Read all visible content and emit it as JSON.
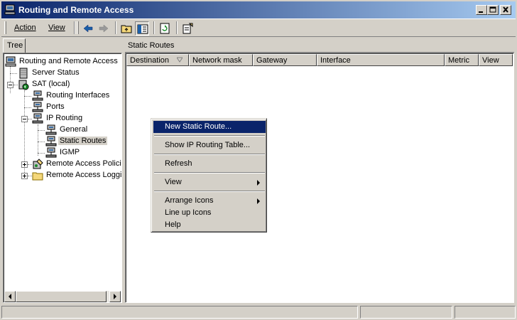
{
  "window": {
    "title": "Routing and Remote Access",
    "title_bg": "#0a246a"
  },
  "toolbar": {
    "menus": [
      "Action",
      "View"
    ],
    "tools": [
      "back-arrow-icon",
      "forward-arrow-icon",
      "up-folder-icon",
      "show-hide-tree-icon",
      "refresh-icon",
      "properties-icon"
    ]
  },
  "tree_tab": "Tree",
  "tree": [
    {
      "label": "Routing and Remote Access"
    },
    {
      "label": "Server Status"
    },
    {
      "label": "SAT (local)"
    },
    {
      "label": "Routing Interfaces"
    },
    {
      "label": "Ports"
    },
    {
      "label": "IP Routing"
    },
    {
      "label": "General"
    },
    {
      "label": "Static Routes"
    },
    {
      "label": "IGMP"
    },
    {
      "label": "Remote Access Policies"
    },
    {
      "label": "Remote Access Logging"
    }
  ],
  "right_pane": {
    "title": "Static Routes",
    "columns": [
      "Destination",
      "Network mask",
      "Gateway",
      "Interface",
      "Metric",
      "View"
    ]
  },
  "context_menu": {
    "items": [
      {
        "label": "New Static Route..."
      },
      {
        "label": "Show IP Routing Table..."
      },
      {
        "label": "Refresh"
      },
      {
        "label": "View"
      },
      {
        "label": "Arrange Icons"
      },
      {
        "label": "Line up Icons"
      },
      {
        "label": "Help"
      }
    ],
    "highlight_color": "#0a246a"
  }
}
